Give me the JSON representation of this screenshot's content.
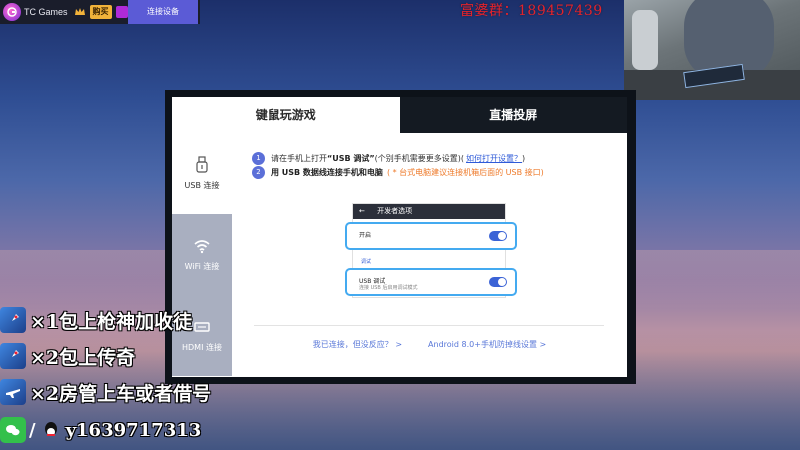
{
  "app": {
    "title": "TC Games",
    "buy_label": "购买",
    "connect_label": "连接设备"
  },
  "banner": {
    "text": "富婆群：189457439"
  },
  "dialog": {
    "tabs": [
      {
        "label": "键鼠玩游戏",
        "active": true
      },
      {
        "label": "直播投屏",
        "active": false
      }
    ],
    "side": [
      {
        "label": "USB 连接",
        "icon": "usb-icon"
      },
      {
        "label": "WiFi 连接",
        "icon": "wifi-icon"
      },
      {
        "label": "HDMI 连接",
        "icon": "hdmi-icon"
      }
    ],
    "step1": {
      "num": "1",
      "prefix": "请在手机上打开",
      "bold": "“USB 调试”",
      "suffix": "(个别手机需要更多设置)(",
      "link": "如何打开设置？",
      "end": ")"
    },
    "step2": {
      "num": "2",
      "bold": "用 USB 数据线连接手机和电脑",
      "note": "( * 台式电脑建议连接机箱后面的 USB 接口)"
    },
    "phone": {
      "header": "开发者选项",
      "row1_label": "开启",
      "section": "调试",
      "row2_label": "USB 调试",
      "row2_sub": "连接 USB 后启用调试模式"
    },
    "links": {
      "no_response": "我已连接，但没反应？ >",
      "android8": "Android 8.0+手机防掉线设置 >"
    }
  },
  "promo": {
    "line1": "×1包上枪神加收徒",
    "line2": "×2包上传奇",
    "line3": "×2房管上车或者借号",
    "qq": "y1639717313"
  },
  "colors": {
    "accent": "#5b6fd8",
    "link": "#2f5bd8",
    "note": "#ee7a2a",
    "toggle": "#3b63d6",
    "highlight_border": "#44aaf0",
    "banner_red": "#e2232c",
    "wechat_green": "#33c04b"
  }
}
